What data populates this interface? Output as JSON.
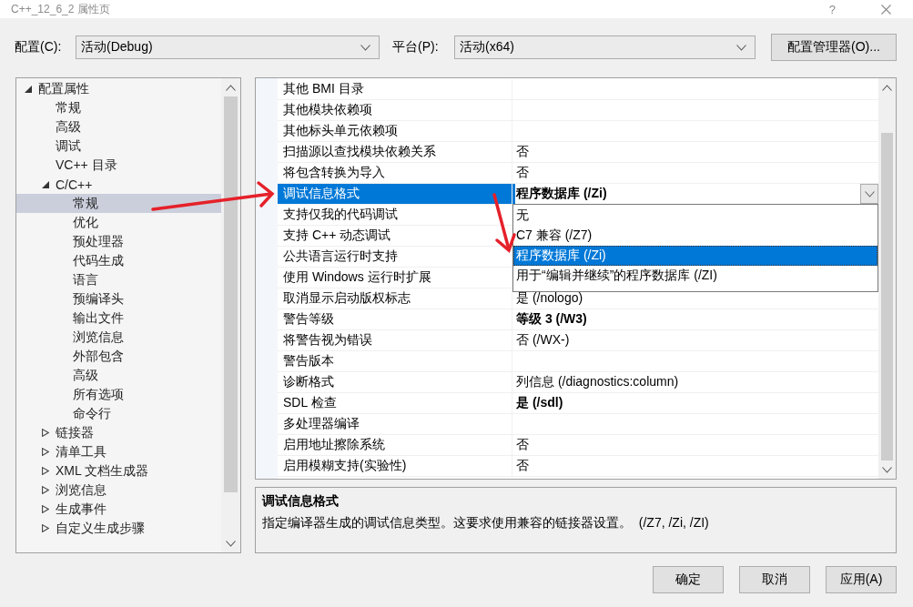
{
  "window": {
    "title": "C++_12_6_2 属性页",
    "help": "?"
  },
  "toolbar": {
    "configuration": {
      "label": "配置(C):",
      "value": "活动(Debug)"
    },
    "platform": {
      "label": "平台(P):",
      "value": "活动(x64)"
    },
    "manager_button": "配置管理器(O)..."
  },
  "tree": [
    {
      "label": "配置属性",
      "kind": "folder",
      "expanded": true,
      "selected": false,
      "children": [
        {
          "label": "常规",
          "kind": "page",
          "selected": false
        },
        {
          "label": "高级",
          "kind": "page",
          "selected": false
        },
        {
          "label": "调试",
          "kind": "page",
          "selected": false
        },
        {
          "label": "VC++ 目录",
          "kind": "page",
          "selected": false
        },
        {
          "label": "C/C++",
          "kind": "folder",
          "expanded": true,
          "selected": false,
          "children": [
            {
              "label": "常规",
              "kind": "page",
              "selected": true
            },
            {
              "label": "优化",
              "kind": "page",
              "selected": false
            },
            {
              "label": "预处理器",
              "kind": "page",
              "selected": false
            },
            {
              "label": "代码生成",
              "kind": "page",
              "selected": false
            },
            {
              "label": "语言",
              "kind": "page",
              "selected": false
            },
            {
              "label": "预编译头",
              "kind": "page",
              "selected": false
            },
            {
              "label": "输出文件",
              "kind": "page",
              "selected": false
            },
            {
              "label": "浏览信息",
              "kind": "page",
              "selected": false
            },
            {
              "label": "外部包含",
              "kind": "page",
              "selected": false
            },
            {
              "label": "高级",
              "kind": "page",
              "selected": false
            },
            {
              "label": "所有选项",
              "kind": "page",
              "selected": false
            },
            {
              "label": "命令行",
              "kind": "page",
              "selected": false
            }
          ]
        },
        {
          "label": "链接器",
          "kind": "folder",
          "expanded": false,
          "selected": false
        },
        {
          "label": "清单工具",
          "kind": "folder",
          "expanded": false,
          "selected": false
        },
        {
          "label": "XML 文档生成器",
          "kind": "folder",
          "expanded": false,
          "selected": false
        },
        {
          "label": "浏览信息",
          "kind": "folder",
          "expanded": false,
          "selected": false
        },
        {
          "label": "生成事件",
          "kind": "folder",
          "expanded": false,
          "selected": false
        },
        {
          "label": "自定义生成步骤",
          "kind": "folder",
          "expanded": false,
          "selected": false
        }
      ]
    }
  ],
  "properties": [
    {
      "name": "其他 BMI 目录",
      "selected": false
    },
    {
      "name": "其他模块依赖项",
      "selected": false
    },
    {
      "name": "其他标头单元依赖项",
      "selected": false
    },
    {
      "name": "扫描源以查找模块依赖关系",
      "value": "否",
      "selected": false,
      "modified": false
    },
    {
      "name": "将包含转换为导入",
      "value": "否",
      "selected": false,
      "modified": false
    },
    {
      "name": "调试信息格式",
      "value": "程序数据库 (/Zi)",
      "selected": true,
      "modified": true,
      "dropdown": {
        "open": true,
        "options": [
          {
            "label": "无",
            "selected": false
          },
          {
            "label": "C7 兼容 (/Z7)",
            "selected": false
          },
          {
            "label": "程序数据库 (/Zi)",
            "selected": true
          },
          {
            "label": "用于“编辑并继续”的程序数据库 (/ZI)",
            "selected": false
          }
        ]
      }
    },
    {
      "name": "支持仅我的代码调试",
      "selected": false
    },
    {
      "name": "支持 C++ 动态调试",
      "selected": false
    },
    {
      "name": "公共语言运行时支持",
      "selected": false
    },
    {
      "name": "使用 Windows 运行时扩展",
      "selected": false
    },
    {
      "name": "取消显示启动版权标志",
      "value": "是 (/nologo)",
      "selected": false,
      "modified": false
    },
    {
      "name": "警告等级",
      "value": "等级 3 (/W3)",
      "selected": false,
      "modified": true
    },
    {
      "name": "将警告视为错误",
      "value": "否 (/WX-)",
      "selected": false,
      "modified": false
    },
    {
      "name": "警告版本",
      "selected": false
    },
    {
      "name": "诊断格式",
      "value": "列信息 (/diagnostics:column)",
      "selected": false,
      "modified": false
    },
    {
      "name": "SDL 检查",
      "value": "是 (/sdl)",
      "selected": false,
      "modified": true
    },
    {
      "name": "多处理器编译",
      "selected": false
    },
    {
      "name": "启用地址擦除系统",
      "value": "否",
      "selected": false,
      "modified": false
    },
    {
      "name": "启用模糊支持(实验性)",
      "value": "否",
      "selected": false,
      "modified": false
    }
  ],
  "description": {
    "title": "调试信息格式",
    "text": "指定编译器生成的调试信息类型。这要求使用兼容的链接器设置。  (/Z7, /Zi, /ZI)"
  },
  "buttons": [
    "确定",
    "取消",
    "应用(A)"
  ]
}
